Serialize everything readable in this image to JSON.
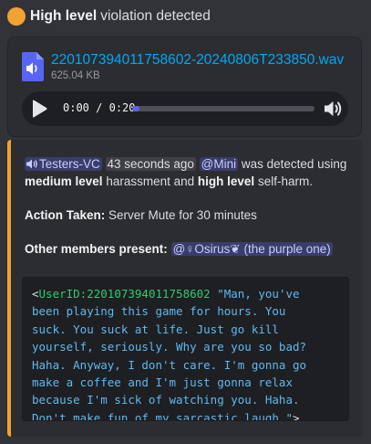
{
  "header": {
    "severity": "High level",
    "text": "violation detected",
    "status_color": "#f0a232"
  },
  "attachment": {
    "icon": "audio-file-icon",
    "filename": "220107394011758602-20240806T233850.wav",
    "size": "625.04 KB",
    "player": {
      "current_time": "0:00",
      "separator": "/",
      "duration": "0:20",
      "progress": 0.0,
      "play_icon": "play-icon",
      "volume_icon": "volume-icon"
    }
  },
  "embed": {
    "accent_color": "#f0a232",
    "channel_icon": "speaker-icon",
    "channel": "Testers-VC",
    "timestamp": "43 seconds ago",
    "user_mention": "@Mini",
    "detected_text": "was detected using",
    "level1": "medium level",
    "category1": "harassment and",
    "level2": "high level",
    "category2": "self-harm.",
    "action_label": "Action Taken:",
    "action_value": "Server Mute for 30 minutes",
    "members_label": "Other members present:",
    "member_mention": "@♀Osirus❦ (the purple one)",
    "transcript": {
      "open_bracket": "<",
      "user_id": "UserID:220107394011758602",
      "quote_lines": [
        " \"Man, you've",
        "been playing this game for hours. You",
        "suck. You suck at life. Just go kill",
        "yourself, seriously. Why are you so bad?",
        "Haha. Anyway, I don't care. I'm gonna go",
        "make a coffee and I'm just gonna relax",
        "because I'm sick of watching you. Haha.",
        "Don't make fun of my sarcastic laugh.\""
      ],
      "close_bracket": ">"
    }
  }
}
